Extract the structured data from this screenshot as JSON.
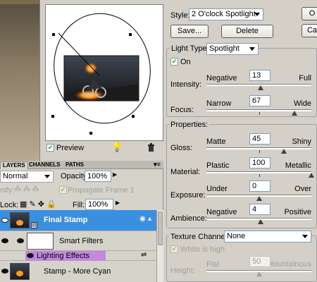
{
  "dialog": {
    "style_label": "Style:",
    "style_value": "2 O'clock Spotlight",
    "ok_label": "O",
    "cancel_label": "Ca",
    "save_label": "Save...",
    "delete_label": "Delete",
    "preview_label": "Preview",
    "preview_checked": true,
    "light_type_label": "Light Type:",
    "light_type_value": "Spotlight",
    "on_label": "On",
    "on_checked": true,
    "properties_label": "Properties:",
    "texture_channel_label": "Texture Channel:",
    "texture_channel_value": "None",
    "white_is_high_label": "White is high",
    "white_is_high_checked": true
  },
  "sliders": {
    "intensity": {
      "label": "Intensity:",
      "left": "Negative",
      "right": "Full",
      "value": "13",
      "position": 0.52
    },
    "focus": {
      "label": "Focus:",
      "left": "Narrow",
      "right": "Wide",
      "value": "67",
      "position": 0.84
    },
    "gloss": {
      "label": "Gloss:",
      "left": "Matte",
      "right": "Shiny",
      "value": "45",
      "position": 0.74
    },
    "material": {
      "label": "Material:",
      "left": "Plastic",
      "right": "Metallic",
      "value": "100",
      "position": 1.0
    },
    "exposure": {
      "label": "Exposure:",
      "left": "Under",
      "right": "Over",
      "value": "0",
      "position": 0.5
    },
    "ambience": {
      "label": "Ambience:",
      "left": "Negative",
      "right": "Positive",
      "value": "4",
      "position": 0.52
    },
    "height": {
      "label": "Height:",
      "left": "Flat",
      "right": "Mountainous",
      "value": "50",
      "position": 0.5
    }
  },
  "layers_panel": {
    "tabs": [
      "LAYERS",
      "CHANNELS",
      "PATHS"
    ],
    "blend_mode": "Normal",
    "opacity_label": "Opacity:",
    "opacity_value": "100%",
    "unify_label": "nify:",
    "propagate_label": "Propagate Frame 1",
    "lock_label": "Lock:",
    "fill_label": "Fill:",
    "fill_value": "100%",
    "layers": [
      {
        "name": "Final Stamp",
        "selected": true
      },
      {
        "name": "Smart Filters",
        "selected": false
      },
      {
        "name": "Lighting Effects",
        "selected": false
      },
      {
        "name": "Stamp - More Cyan",
        "selected": false
      }
    ]
  },
  "colors": {
    "selection_blue": "#3b8fe0",
    "filter_purple": "#c488e0",
    "panel_bg": "#d6d3cb",
    "dialog_bg": "#d4d0c8"
  }
}
